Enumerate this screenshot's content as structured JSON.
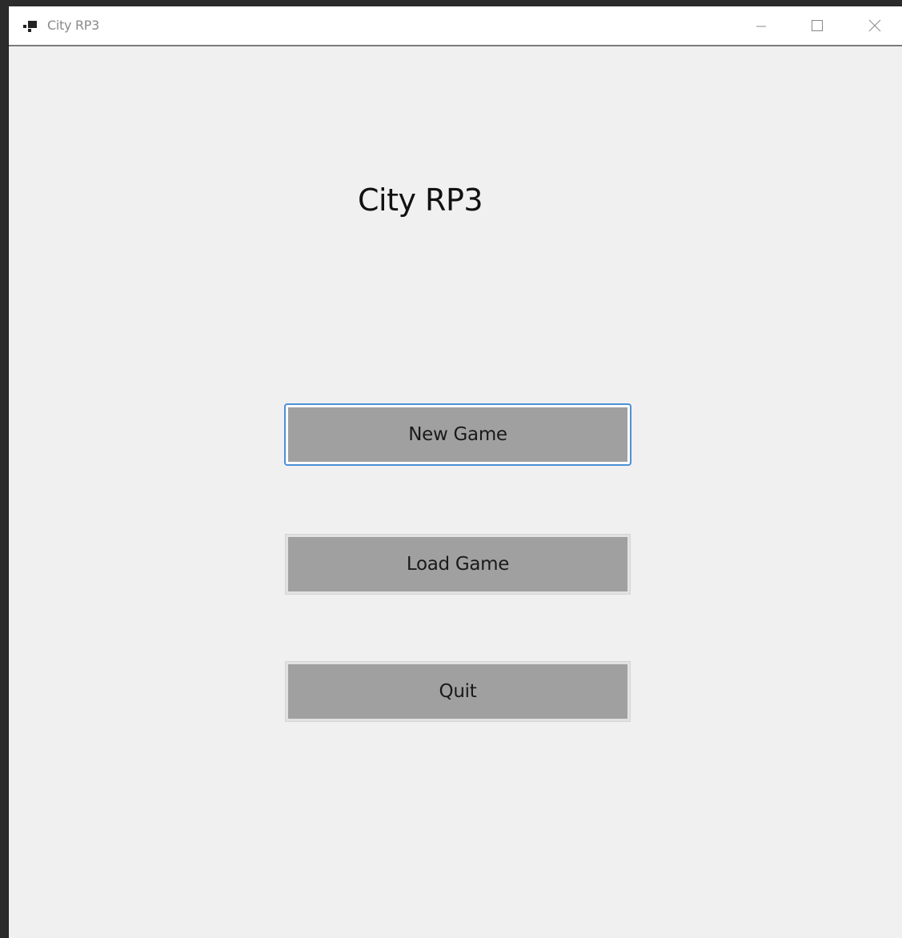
{
  "window": {
    "title": "City RP3",
    "controls": {
      "minimize_icon": "minimize-icon",
      "maximize_icon": "maximize-icon",
      "close_icon": "close-icon"
    }
  },
  "main": {
    "heading": "City RP3",
    "buttons": [
      {
        "label": "New Game",
        "focused": true
      },
      {
        "label": "Load Game",
        "focused": false
      },
      {
        "label": "Quit",
        "focused": false
      }
    ]
  },
  "colors": {
    "background": "#f0f0f0",
    "button_fill": "#a0a0a0",
    "focus_ring": "#4a90d9"
  }
}
